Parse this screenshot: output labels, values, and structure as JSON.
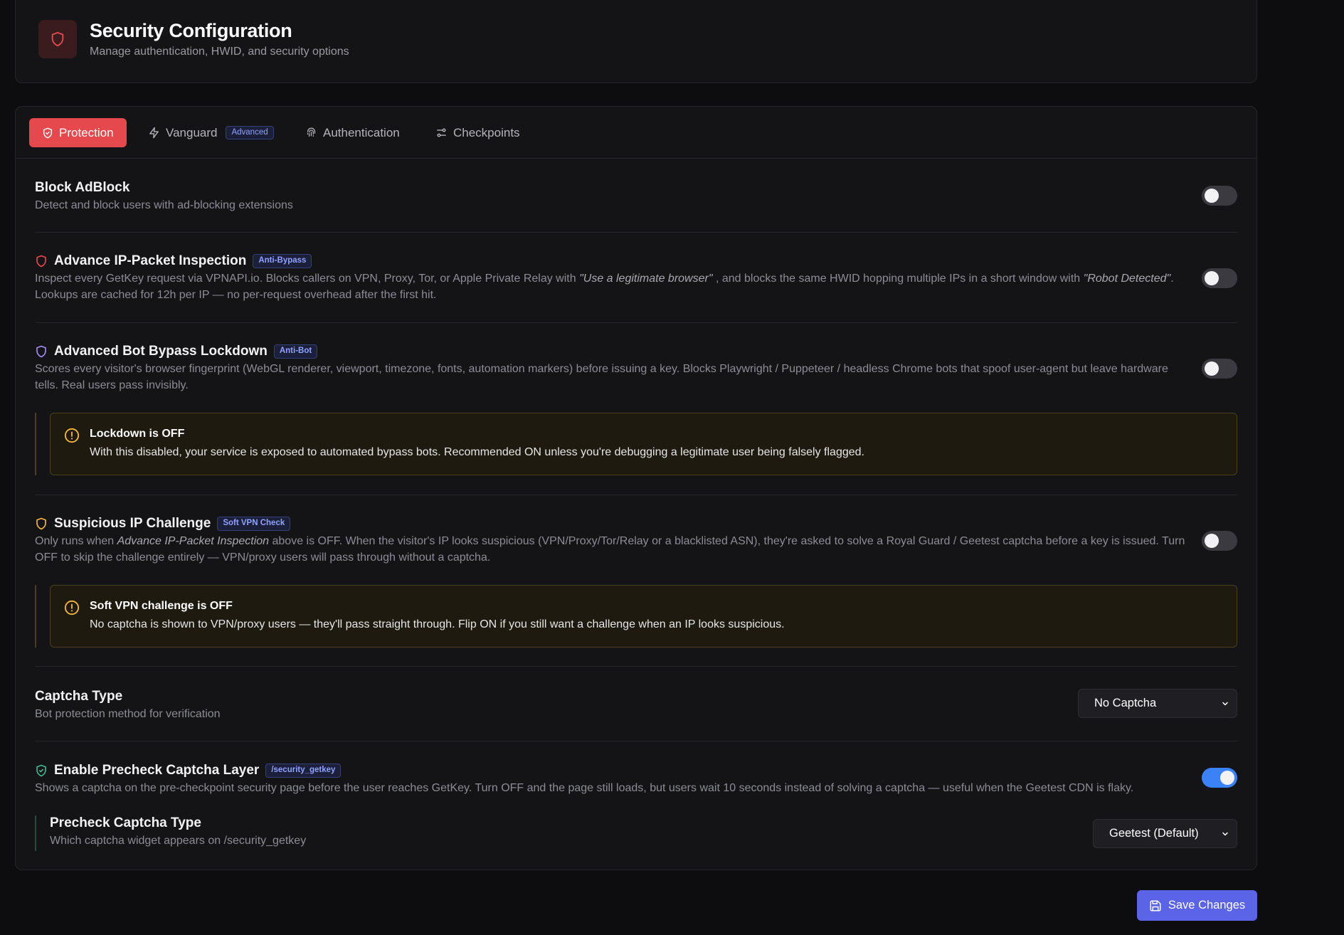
{
  "header": {
    "title": "Security Configuration",
    "subtitle": "Manage authentication, HWID, and security options",
    "icon": "shield-icon"
  },
  "tabs": [
    {
      "label": "Protection",
      "icon": "shield-check-icon",
      "active": true
    },
    {
      "label": "Vanguard",
      "icon": "lightning-icon",
      "badge": "Advanced"
    },
    {
      "label": "Authentication",
      "icon": "fingerprint-icon"
    },
    {
      "label": "Checkpoints",
      "icon": "sliders-icon"
    }
  ],
  "settings": {
    "block_adblock": {
      "title": "Block AdBlock",
      "desc": "Detect and block users with ad-blocking extensions",
      "enabled": false
    },
    "ip_inspection": {
      "title": "Advance IP-Packet Inspection",
      "badge": "Anti-Bypass",
      "desc_1": "Inspect every GetKey request via VPNAPI.io. Blocks callers on VPN, Proxy, Tor, or Apple Private Relay with ",
      "desc_em_1": "\"Use a legitimate browser\"",
      "desc_2": " , and blocks the same HWID hopping multiple IPs in a short window with ",
      "desc_em_2": "\"Robot Detected\"",
      "desc_3": ". Lookups are cached for 12h per IP — no per-request overhead after the first hit.",
      "enabled": false,
      "icon_color": "#e5484d"
    },
    "bot_lockdown": {
      "title": "Advanced Bot Bypass Lockdown",
      "badge": "Anti-Bot",
      "desc": "Scores every visitor's browser fingerprint (WebGL renderer, viewport, timezone, fonts, automation markers) before issuing a key. Blocks Playwright / Puppeteer / headless Chrome bots that spoof user-agent but leave hardware tells. Real users pass invisibly.",
      "enabled": false,
      "icon_color": "#a78bfa",
      "warning_title": "Lockdown is OFF",
      "warning_text": "With this disabled, your service is exposed to automated bypass bots. Recommended ON unless you're debugging a legitimate user being falsely flagged."
    },
    "suspicious_ip": {
      "title": "Suspicious IP Challenge",
      "badge": "Soft VPN Check",
      "desc_1": "Only runs when ",
      "desc_em": "Advance IP-Packet Inspection",
      "desc_2": " above is OFF. When the visitor's IP looks suspicious (VPN/Proxy/Tor/Relay or a blacklisted ASN), they're asked to solve a Royal Guard / Geetest captcha before a key is issued. Turn OFF to skip the challenge entirely — VPN/proxy users will pass through without a captcha.",
      "enabled": false,
      "icon_color": "#f5b83d",
      "warning_title": "Soft VPN challenge is OFF",
      "warning_text": "No captcha is shown to VPN/proxy users — they'll pass straight through. Flip ON if you still want a challenge when an IP looks suspicious."
    },
    "captcha_type": {
      "title": "Captcha Type",
      "desc": "Bot protection method for verification",
      "value": "No Captcha"
    },
    "precheck": {
      "title": "Enable Precheck Captcha Layer",
      "badge": "/security_getkey",
      "desc": "Shows a captcha on the pre-checkpoint security page before the user reaches GetKey. Turn OFF and the page still loads, but users wait 10 seconds instead of solving a captcha — useful when the Geetest CDN is flaky.",
      "enabled": true,
      "icon_color": "#3fb68b"
    },
    "precheck_type": {
      "title": "Precheck Captcha Type",
      "desc": "Which captcha widget appears on /security_getkey",
      "value": "Geetest (Default)"
    }
  },
  "footer": {
    "save_label": "Save Changes",
    "save_icon": "save-icon"
  },
  "colors": {
    "accent_red": "#e5484d",
    "accent_blue": "#3b82f6",
    "button_indigo": "#5b63e6",
    "warning_amber": "#f5b83d"
  }
}
